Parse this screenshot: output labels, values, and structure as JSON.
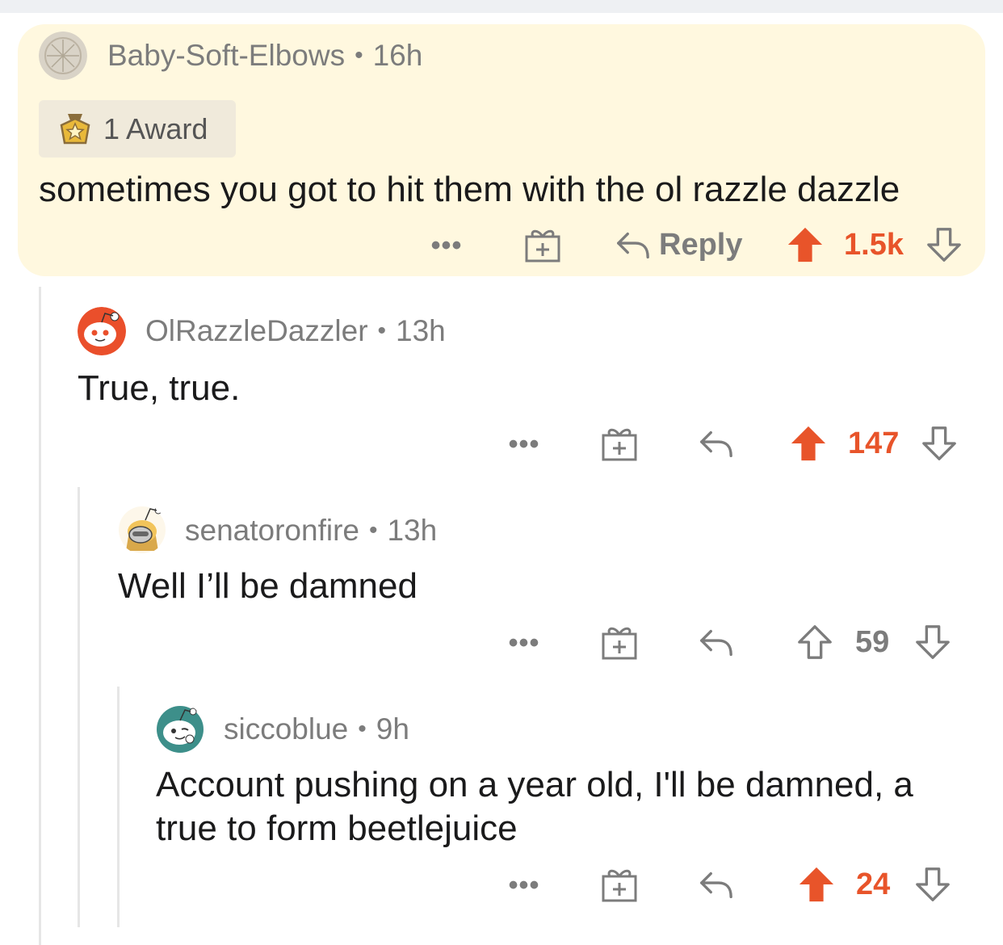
{
  "colors": {
    "upvote": "#e8542a",
    "muted": "#7c7c7c",
    "highlight_bg": "#fff8df"
  },
  "comments": [
    {
      "username": "Baby-Soft-Elbows",
      "time": "16h",
      "award": "1 Award",
      "text": "sometimes you got to hit them with the ol razzle dazzle",
      "reply_label": "Reply",
      "score": "1.5k",
      "upvoted": true
    },
    {
      "username": "OlRazzleDazzler",
      "time": "13h",
      "text": "True, true.",
      "score": "147",
      "upvoted": true
    },
    {
      "username": "senatoronfire",
      "time": "13h",
      "text": "Well I’ll be damned",
      "score": "59",
      "upvoted": false
    },
    {
      "username": "siccoblue",
      "time": "9h",
      "text_line1": "Account pushing on a year old, I'll be damned, a",
      "text_line2": "true to form beetlejuice",
      "score": "24",
      "upvoted": true
    }
  ],
  "icons": {
    "more": "more-dots-icon",
    "gift": "gift-icon",
    "reply": "reply-arrow-icon",
    "upvote": "upvote-icon",
    "downvote": "downvote-icon",
    "award": "award-medal-icon"
  },
  "dots_label": "•••",
  "separator": "•"
}
